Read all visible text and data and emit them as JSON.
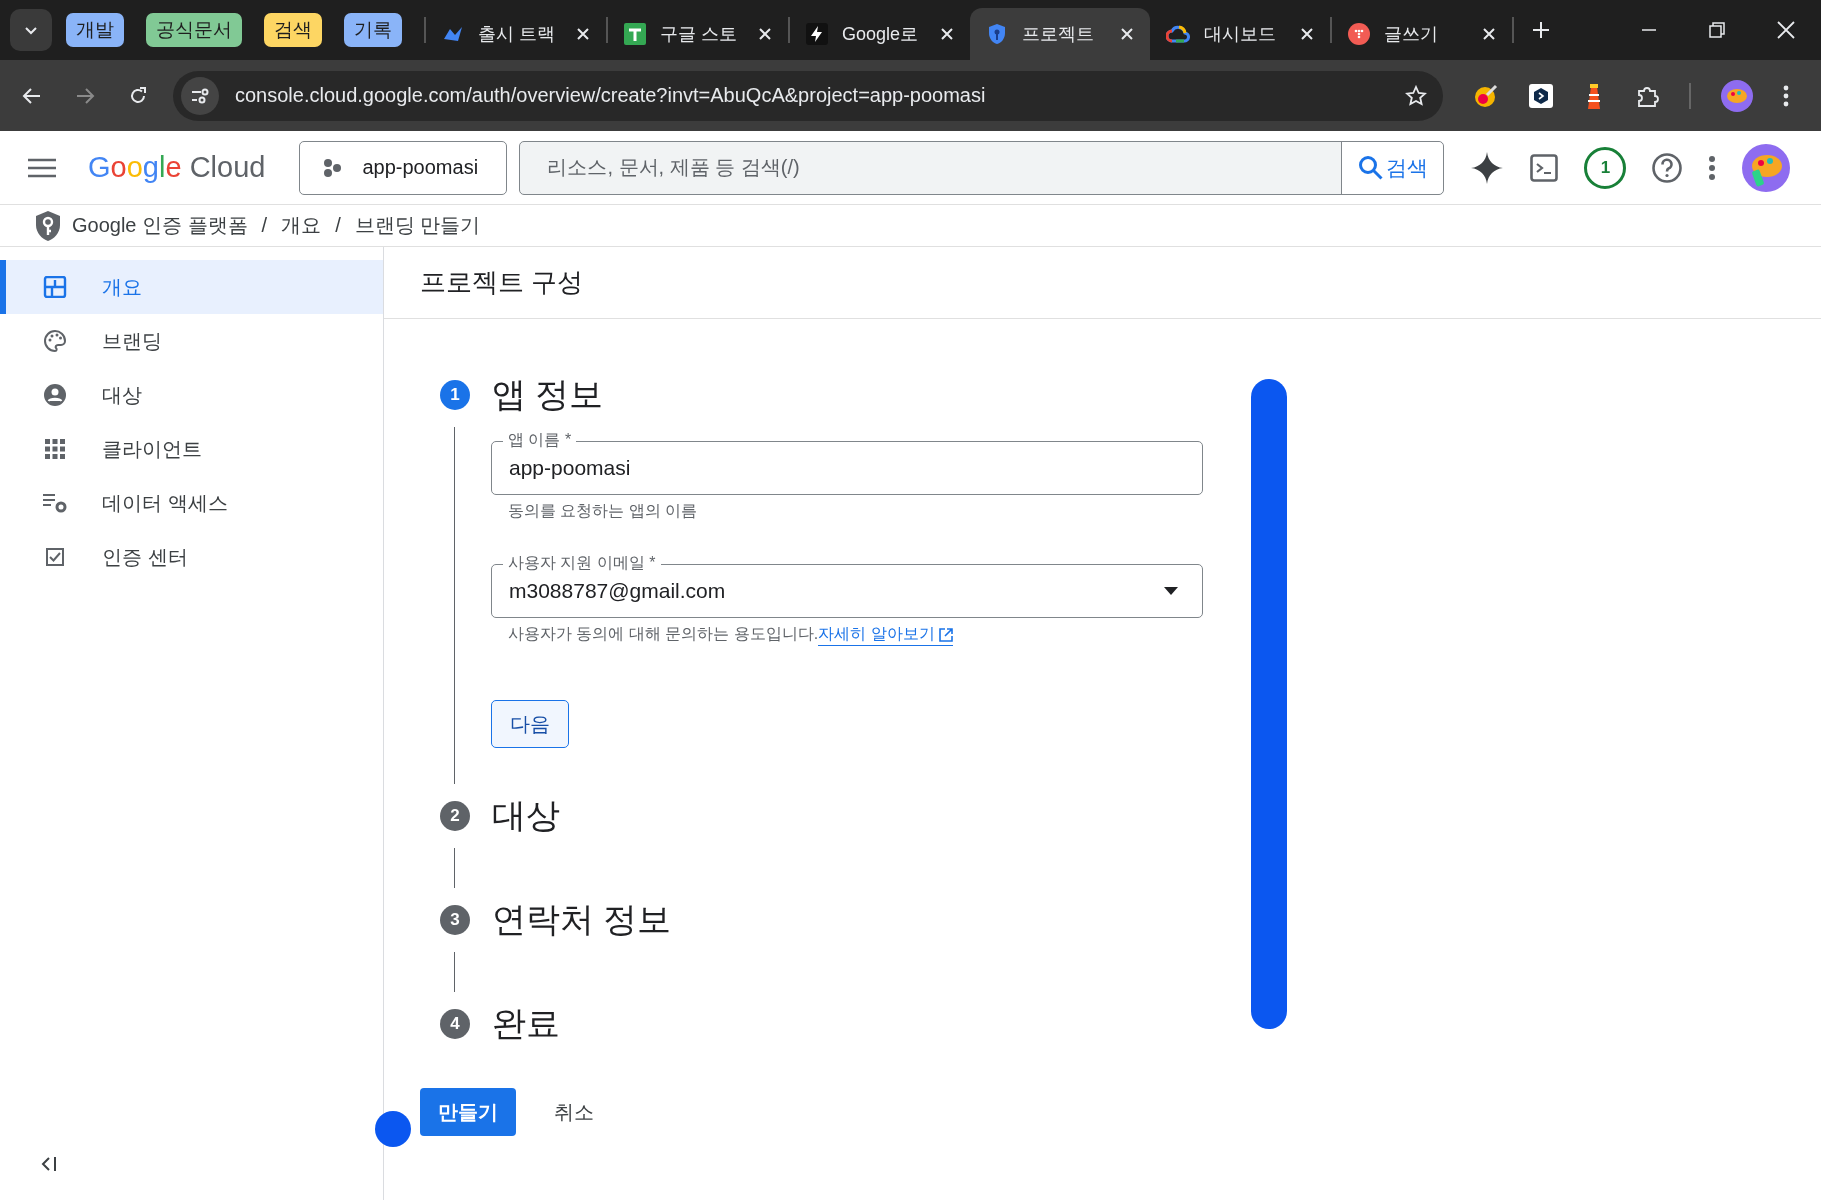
{
  "browser": {
    "tab_groups": [
      {
        "label": "개발",
        "color": "#8ab4f8"
      },
      {
        "label": "공식문서",
        "color": "#81c995"
      },
      {
        "label": "검색",
        "color": "#fdd663"
      },
      {
        "label": "기록",
        "color": "#8ab4f8"
      }
    ],
    "tabs": [
      {
        "title": "출시 트랙",
        "selected": false
      },
      {
        "title": "구글 스토",
        "selected": false
      },
      {
        "title": "Google로",
        "selected": false
      },
      {
        "title": "프로젝트",
        "selected": true
      },
      {
        "title": "대시보드",
        "selected": false
      },
      {
        "title": "글쓰기",
        "selected": false
      }
    ],
    "address": "console.cloud.google.com/auth/overview/create?invt=AbuQcA&project=app-poomasi"
  },
  "header": {
    "logo": "Google Cloud",
    "project": "app-poomasi",
    "search_placeholder": "리소스, 문서, 제품 등 검색(/)",
    "search_button": "검색",
    "notification_count": "1"
  },
  "breadcrumb": [
    "Google 인증 플랫폼",
    "개요",
    "브랜딩 만들기"
  ],
  "breadcrumb_separator": "/",
  "sidebar": {
    "items": [
      {
        "label": "개요",
        "selected": true
      },
      {
        "label": "브랜딩",
        "selected": false
      },
      {
        "label": "대상",
        "selected": false
      },
      {
        "label": "클라이언트",
        "selected": false
      },
      {
        "label": "데이터 액세스",
        "selected": false
      },
      {
        "label": "인증 센터",
        "selected": false
      }
    ]
  },
  "page_title": "프로젝트 구성",
  "steps": [
    {
      "number": "1",
      "title": "앱 정보",
      "active": true
    },
    {
      "number": "2",
      "title": "대상",
      "active": false
    },
    {
      "number": "3",
      "title": "연락처 정보",
      "active": false
    },
    {
      "number": "4",
      "title": "완료",
      "active": false
    }
  ],
  "fields": [
    {
      "kind": "text",
      "label": "앱 이름 *",
      "value": "app-poomasi",
      "helper": "동의를 요청하는 앱의 이름"
    },
    {
      "kind": "select",
      "label": "사용자 지원 이메일 *",
      "value": "m3088787@gmail.com",
      "helper": "사용자가 동의에 대해 문의하는 용도입니다.",
      "link": "자세히 알아보기"
    }
  ],
  "next_button": "다음",
  "create_button": "만들기",
  "cancel_button": "취소"
}
